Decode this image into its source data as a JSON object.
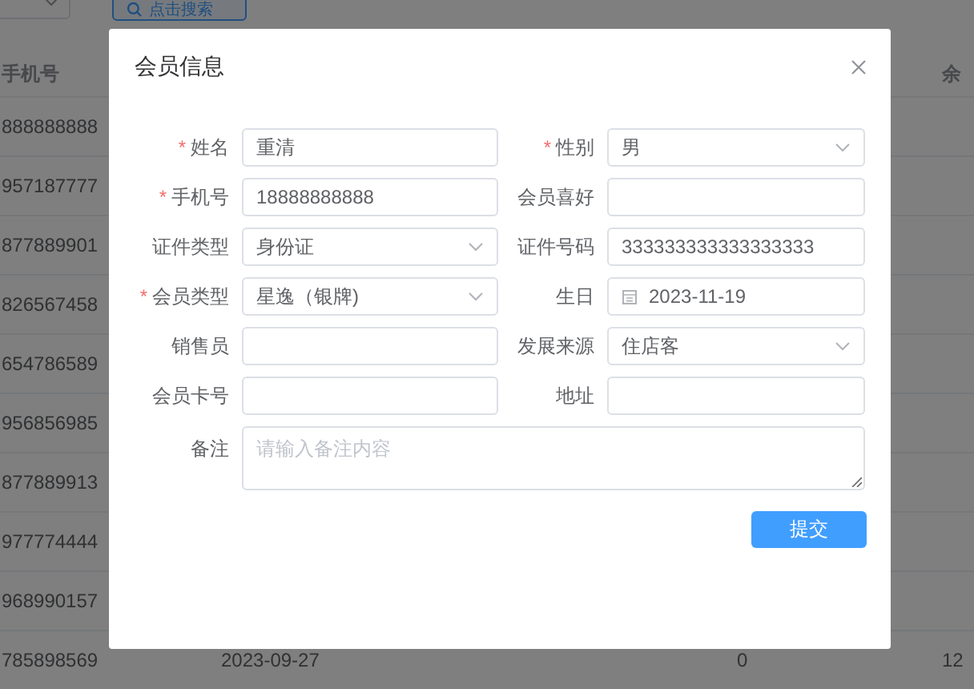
{
  "toolbar": {
    "search_button": "点击搜索"
  },
  "table": {
    "phone_header": "手机号",
    "column_4_header": "余",
    "rows": [
      {
        "phone": "888888888"
      },
      {
        "phone": "957187777"
      },
      {
        "phone": "877889901"
      },
      {
        "phone": "826567458"
      },
      {
        "phone": "654786589"
      },
      {
        "phone": "956856985"
      },
      {
        "phone": "877889913"
      },
      {
        "phone": "977774444"
      },
      {
        "phone": "968990157"
      },
      {
        "phone": "785898569",
        "date": "2023-09-27",
        "column_3": "0",
        "column_4": "12"
      }
    ]
  },
  "dialog": {
    "title": "会员信息",
    "fields": [
      {
        "label": "姓名",
        "required_mark": "*",
        "kind": "input",
        "value": "重清"
      },
      {
        "label": "性别",
        "required_mark": "*",
        "kind": "select",
        "value": "男"
      },
      {
        "label": "手机号",
        "required_mark": "*",
        "kind": "input",
        "value": "18888888888"
      },
      {
        "label": "会员喜好",
        "kind": "input"
      },
      {
        "label": "证件类型",
        "kind": "select",
        "value": "身份证"
      },
      {
        "label": "证件号码",
        "kind": "input",
        "value": "333333333333333333"
      },
      {
        "label": "会员类型",
        "required_mark": "*",
        "kind": "select",
        "value": "星逸（银牌)"
      },
      {
        "label": "生日",
        "kind": "date",
        "value": "2023-11-19"
      },
      {
        "label": "销售员",
        "kind": "input"
      },
      {
        "label": "发展来源",
        "kind": "select",
        "value": "住店客"
      },
      {
        "label": "会员卡号",
        "kind": "input"
      },
      {
        "label": "地址",
        "kind": "input"
      },
      {
        "label": "备注",
        "kind": "textarea",
        "placeholder": "请输入备注内容"
      }
    ],
    "submit_button": "提交"
  }
}
